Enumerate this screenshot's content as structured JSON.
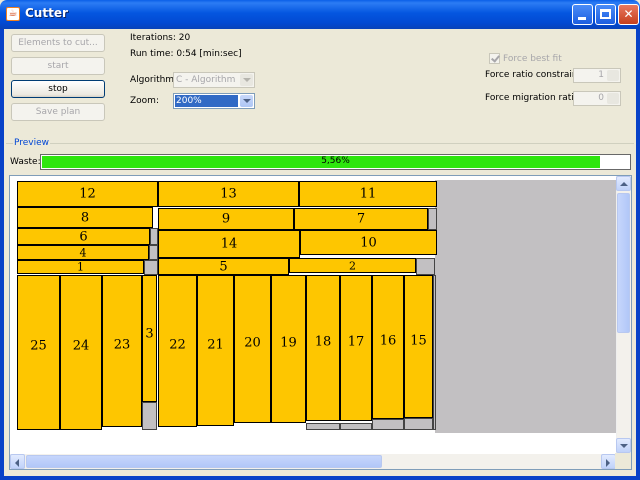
{
  "window": {
    "title": "Cutter",
    "icon": "java-cup-icon",
    "titlebar_color": "#0556e2"
  },
  "controls": {
    "elements_to_cut": "Elements to cut...",
    "start": "start",
    "stop": "stop",
    "save_plan": "Save plan"
  },
  "status": {
    "iterations": "Iterations: 20",
    "run_time": "Run time: 0:54 [min:sec]"
  },
  "algorithm": {
    "label": "Algorithm:",
    "value": "C - Algorithm"
  },
  "zoom": {
    "label": "Zoom:",
    "value": "200%"
  },
  "options": {
    "force_best_fit": "Force best fit",
    "force_best_fit_checked": true,
    "ratio_constraint_label": "Force ratio constraint:",
    "ratio_constraint_value": "1",
    "migration_ratio_label": "Force migration ratio:",
    "migration_ratio_value": "0"
  },
  "preview": {
    "title": "Preview",
    "waste_label": "Waste:",
    "waste_text": "5,56%",
    "waste_fill_fraction": 0.947,
    "piece_color": "#fec600",
    "waste_color": "#2ee60e"
  },
  "pieces": [
    {
      "id": "12",
      "label": "12"
    },
    {
      "id": "13",
      "label": "13"
    },
    {
      "id": "11",
      "label": "11"
    },
    {
      "id": "8",
      "label": "8"
    },
    {
      "id": "9",
      "label": "9"
    },
    {
      "id": "7",
      "label": "7"
    },
    {
      "id": "6",
      "label": "6"
    },
    {
      "id": "14",
      "label": "14"
    },
    {
      "id": "10",
      "label": "10"
    },
    {
      "id": "4",
      "label": "4"
    },
    {
      "id": "1",
      "label": "1"
    },
    {
      "id": "5",
      "label": "5"
    },
    {
      "id": "2",
      "label": "2"
    },
    {
      "id": "25",
      "label": "25"
    },
    {
      "id": "24",
      "label": "24"
    },
    {
      "id": "23",
      "label": "23"
    },
    {
      "id": "3",
      "label": "3"
    },
    {
      "id": "22",
      "label": "22"
    },
    {
      "id": "21",
      "label": "21"
    },
    {
      "id": "20",
      "label": "20"
    },
    {
      "id": "19",
      "label": "19"
    },
    {
      "id": "18",
      "label": "18"
    },
    {
      "id": "17",
      "label": "17"
    },
    {
      "id": "16",
      "label": "16"
    },
    {
      "id": "15",
      "label": "15"
    }
  ]
}
